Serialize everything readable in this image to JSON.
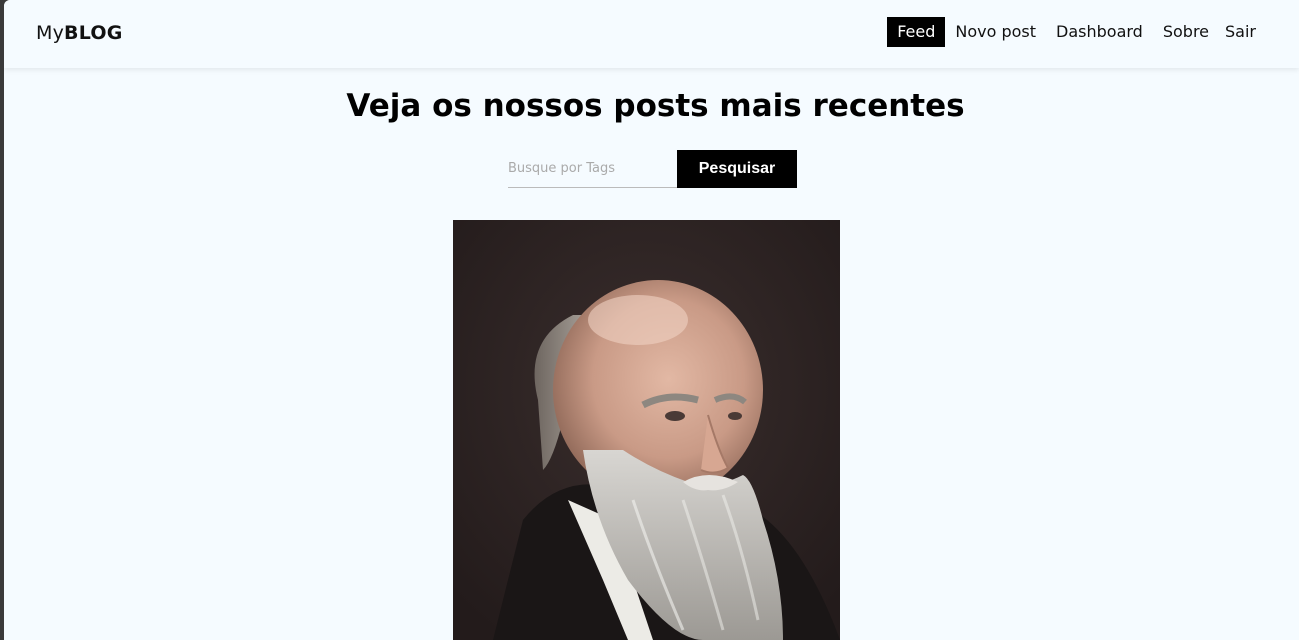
{
  "brand": {
    "prefix": "My",
    "bold": "BLOG"
  },
  "nav": {
    "items": [
      {
        "label": "Feed",
        "active": true
      },
      {
        "label": "Novo post",
        "active": false
      },
      {
        "label": "Dashboard",
        "active": false
      },
      {
        "label": "Sobre",
        "active": false
      },
      {
        "label": "Sair",
        "active": false
      }
    ]
  },
  "main": {
    "headline": "Veja os nossos posts mais recentes",
    "search": {
      "placeholder": "Busque por Tags",
      "value": "",
      "button_label": "Pesquisar"
    }
  },
  "colors": {
    "page_bg": "#f5fbff",
    "accent": "#000000",
    "text": "#111111"
  }
}
